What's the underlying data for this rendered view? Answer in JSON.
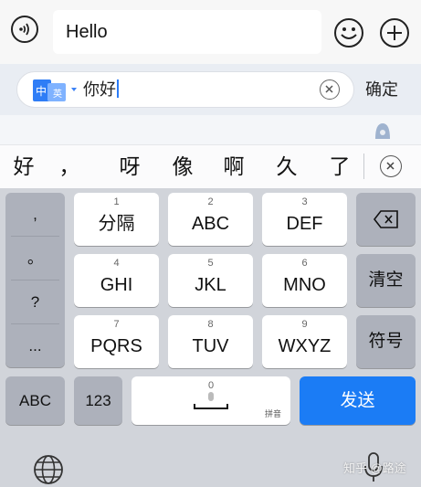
{
  "chat_input": {
    "value": "Hello",
    "icons": [
      "voice-input-icon",
      "emoji-icon",
      "plus-icon"
    ]
  },
  "ime_compose": {
    "lang_badge_left": "中",
    "lang_badge_right": "英",
    "text": "你好",
    "confirm_label": "确定",
    "icons": [
      "clear-circle-icon",
      "assistant-icon"
    ]
  },
  "candidates": [
    "好",
    "，",
    "呀",
    "像",
    "啊",
    "久",
    "了"
  ],
  "punctuation": [
    ",",
    "。",
    "?",
    "..."
  ],
  "t9_keys": [
    {
      "num": "1",
      "label": "分隔"
    },
    {
      "num": "2",
      "label": "ABC"
    },
    {
      "num": "3",
      "label": "DEF"
    },
    {
      "num": "4",
      "label": "GHI"
    },
    {
      "num": "5",
      "label": "JKL"
    },
    {
      "num": "6",
      "label": "MNO"
    },
    {
      "num": "7",
      "label": "PQRS"
    },
    {
      "num": "8",
      "label": "TUV"
    },
    {
      "num": "9",
      "label": "WXYZ"
    }
  ],
  "side_keys": {
    "clear": "清空",
    "symbols": "符号"
  },
  "bottom_row": {
    "abc": "ABC",
    "num123": "123",
    "space_num": "0",
    "space_sub": "拼音",
    "send": "发送"
  },
  "watermark": "知乎 @路途",
  "colors": {
    "send_blue": "#1b7cf5",
    "keyboard_bg": "#d1d4da",
    "dark_key": "#adb1bb",
    "caret_blue": "#2b7cf7"
  }
}
